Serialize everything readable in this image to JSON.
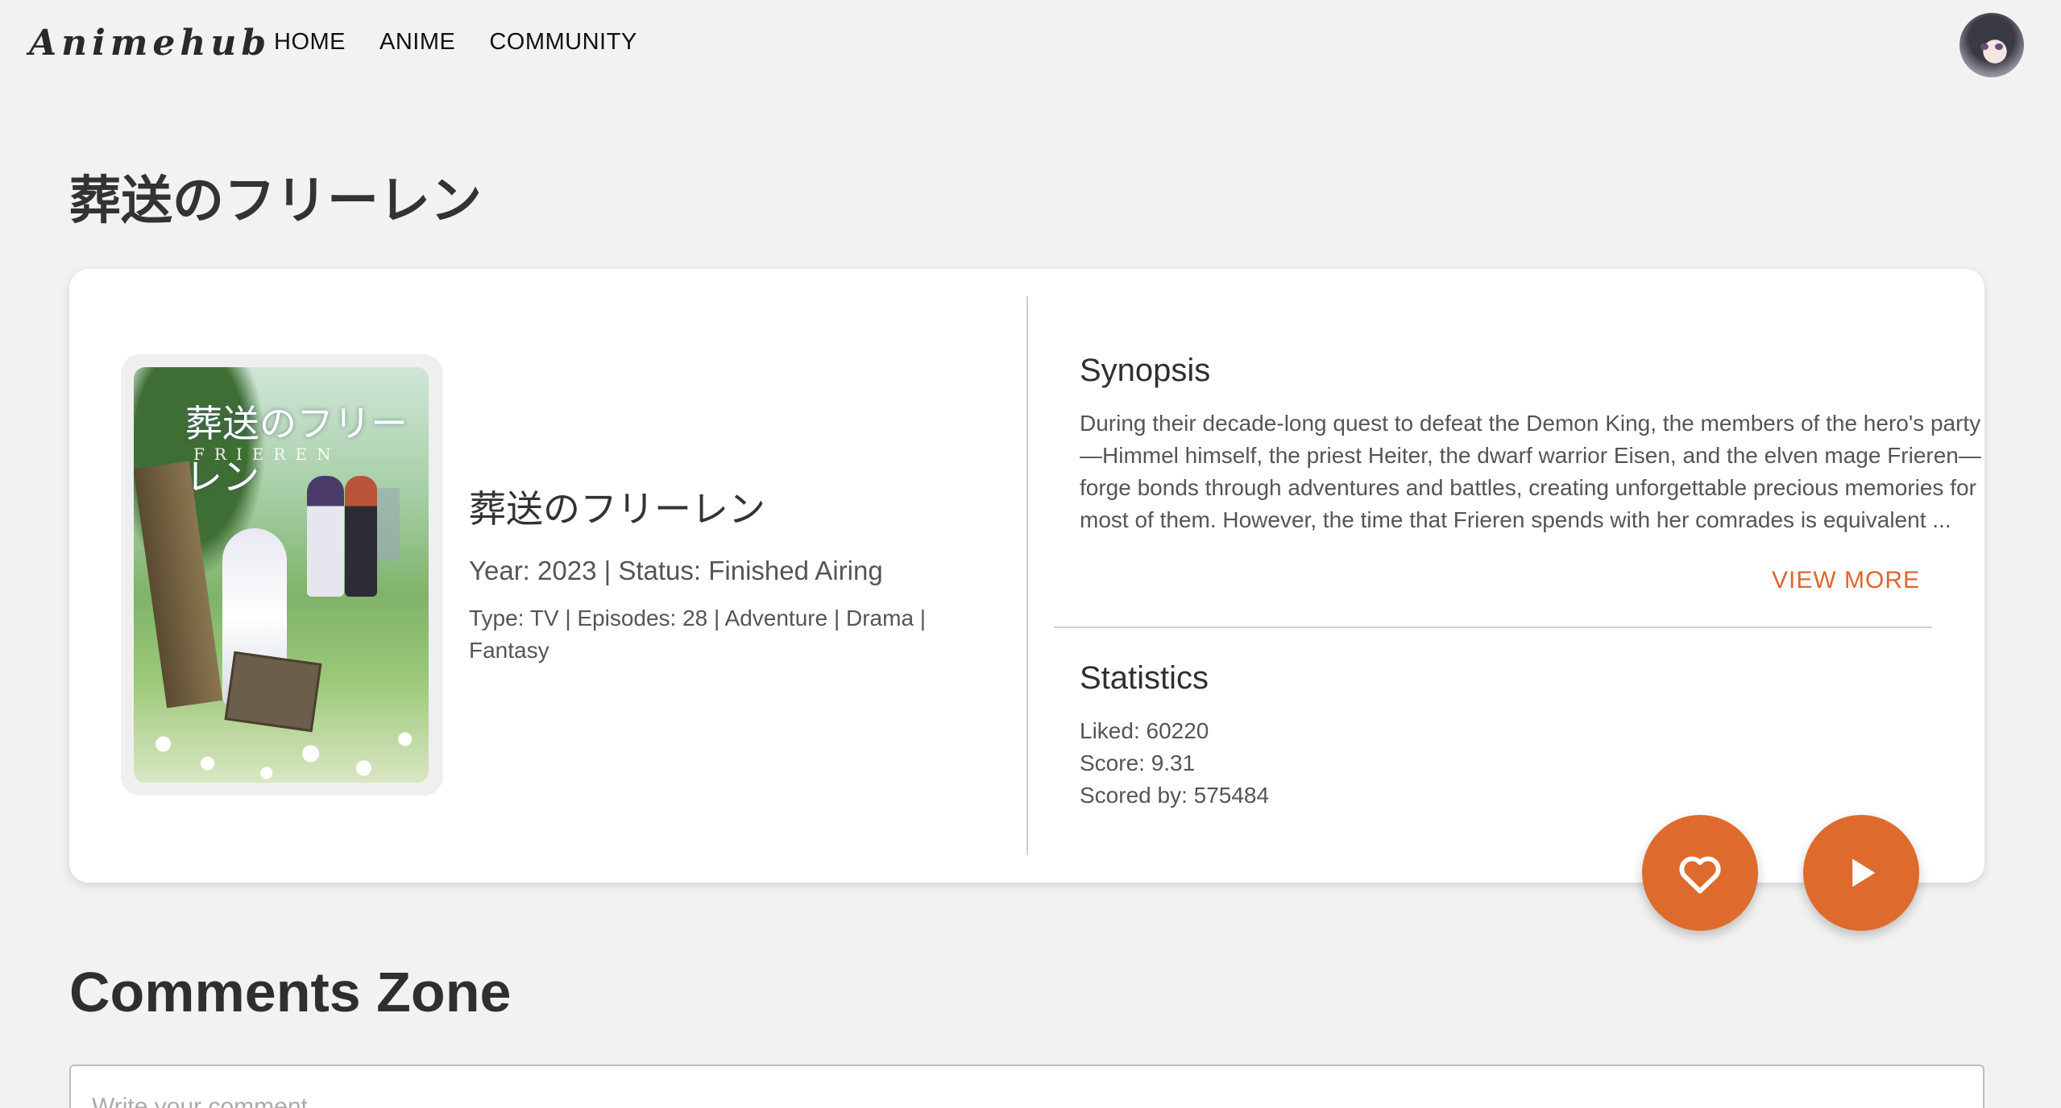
{
  "nav": {
    "logo": "Animehub",
    "links": [
      "HOME",
      "ANIME",
      "COMMUNITY"
    ]
  },
  "page": {
    "title": "葬送のフリーレン"
  },
  "anime": {
    "poster_title": "葬送のフリーレン",
    "poster_subtitle": "FRIEREN",
    "title": "葬送のフリーレン",
    "year_status": "Year: 2023 | Status: Finished Airing",
    "type_line": "Type: TV | Episodes: 28 | Adventure | Drama | Fantasy"
  },
  "synopsis": {
    "heading": "Synopsis",
    "text": "During their decade-long quest to defeat the Demon King, the members of the hero's party—Himmel himself, the priest Heiter, the dwarf warrior Eisen, and the elven mage Frieren—forge bonds through adventures and battles, creating unforgettable precious memories for most of them. However, the time that Frieren spends with her comrades is equivalent ...",
    "view_more": "VIEW MORE"
  },
  "statistics": {
    "heading": "Statistics",
    "liked": "Liked: 60220",
    "score": "Score: 9.31",
    "scored_by": "Scored by: 575484"
  },
  "actions": {
    "like_icon": "heart-outline-icon",
    "play_icon": "play-icon"
  },
  "comments": {
    "title": "Comments Zone",
    "placeholder": "Write your comment..."
  },
  "colors": {
    "accent": "#df6a2d",
    "background": "#f2f2f2"
  }
}
